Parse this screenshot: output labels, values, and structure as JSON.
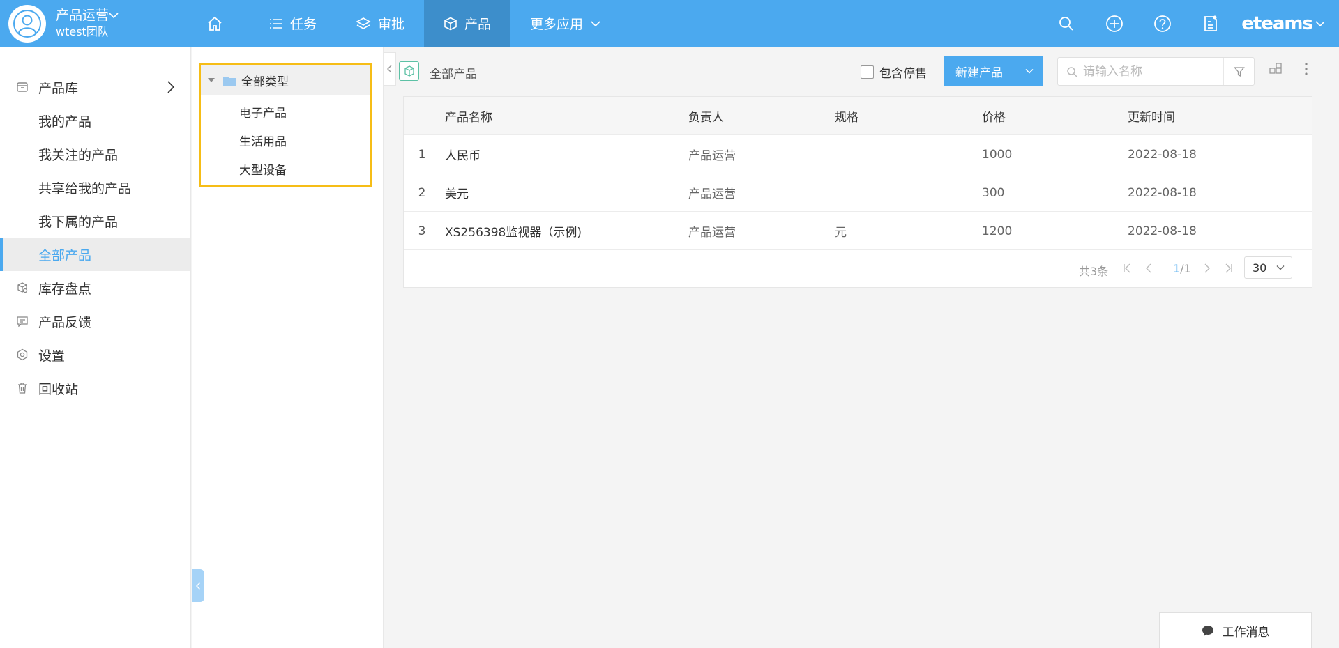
{
  "header": {
    "team_name": "产品运营",
    "team_sub": "wtest团队",
    "nav": [
      {
        "label": "任务"
      },
      {
        "label": "审批"
      },
      {
        "label": "产品"
      },
      {
        "label": "更多应用"
      }
    ],
    "brand": "eteams",
    "colors": {
      "bar": "#4ba9ef",
      "active": "#3d8ecb"
    }
  },
  "sidebar": {
    "items": [
      {
        "label": "产品库",
        "icon": "box-icon"
      },
      {
        "label": "我的产品"
      },
      {
        "label": "我关注的产品"
      },
      {
        "label": "共享给我的产品"
      },
      {
        "label": "我下属的产品"
      },
      {
        "label": "全部产品",
        "active": true
      },
      {
        "label": "库存盘点",
        "icon": "inventory-icon"
      },
      {
        "label": "产品反馈",
        "icon": "comment-icon"
      },
      {
        "label": "设置",
        "icon": "settings-icon"
      },
      {
        "label": "回收站",
        "icon": "trash-icon"
      }
    ]
  },
  "tree": {
    "root": "全部类型",
    "children": [
      "电子产品",
      "生活用品",
      "大型设备"
    ]
  },
  "toolbar": {
    "title": "全部产品",
    "include_discontinued_label": "包含停售",
    "include_discontinued_checked": false,
    "new_button_label": "新建产品",
    "search_placeholder": "请输入名称"
  },
  "table": {
    "columns": [
      "产品名称",
      "负责人",
      "规格",
      "价格",
      "更新时间"
    ],
    "rows": [
      {
        "idx": "1",
        "name": "人民币",
        "owner": "产品运营",
        "spec": "",
        "price": "1000",
        "time": "2022-08-18"
      },
      {
        "idx": "2",
        "name": "美元",
        "owner": "产品运营",
        "spec": "",
        "price": "300",
        "time": "2022-08-18"
      },
      {
        "idx": "3",
        "name": "XS256398监视器（示例)",
        "owner": "产品运营",
        "spec": "元",
        "price": "1200",
        "time": "2022-08-18"
      }
    ]
  },
  "pager": {
    "total": "共3条",
    "current": "1",
    "pages": "/1",
    "page_size": "30"
  },
  "work_message": "工作消息"
}
